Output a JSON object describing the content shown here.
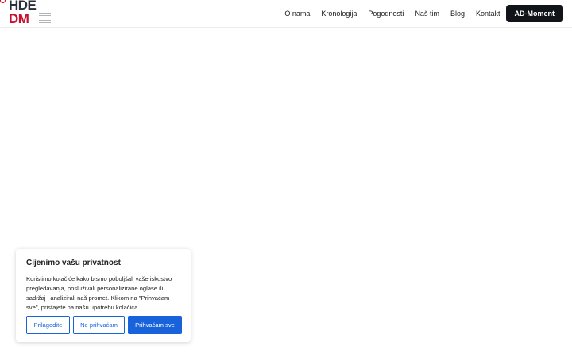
{
  "header": {
    "logo": {
      "row1": "HDE",
      "row2": "DM"
    },
    "nav": [
      "O nama",
      "Kronologija",
      "Pogodnosti",
      "Naš tim",
      "Blog",
      "Kontakt"
    ],
    "cta_label": "AD-Moment"
  },
  "cookie_banner": {
    "title": "Cijenimo vašu privatnost",
    "text": "Koristimo kolačiće kako bismo poboljšali vaše iskustvo pregledavanja, posluživali personalizirane oglase ili sadržaj i analizirali naš promet. Klikom na \"Prihvaćam sve\", pristajete na našu upotrebu kolačića.",
    "customize_label": "Prilagodite",
    "reject_label": "Ne prihvaćam",
    "accept_label": "Prihvaćam sve"
  },
  "colors": {
    "brand_dark": "#2b2f3a",
    "brand_red": "#c8102e",
    "cta_bg": "#111418",
    "consent_blue": "#1863dc"
  }
}
